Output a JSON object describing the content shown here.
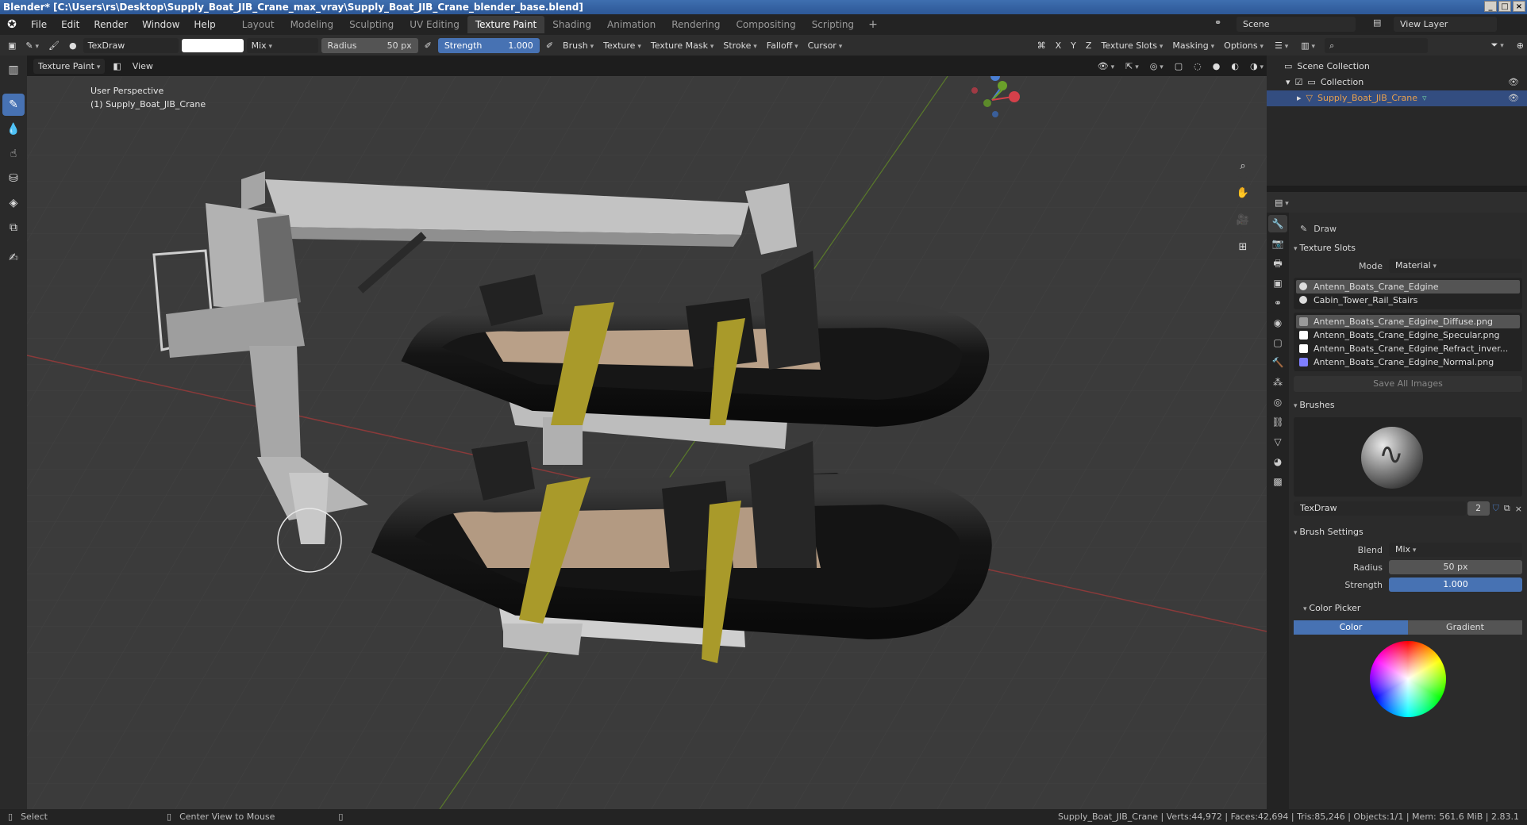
{
  "window": {
    "title": "Blender* [C:\\Users\\rs\\Desktop\\Supply_Boat_JIB_Crane_max_vray\\Supply_Boat_JIB_Crane_blender_base.blend]"
  },
  "menu": [
    "File",
    "Edit",
    "Render",
    "Window",
    "Help"
  ],
  "workspaces": [
    "Layout",
    "Modeling",
    "Sculpting",
    "UV Editing",
    "Texture Paint",
    "Shading",
    "Animation",
    "Rendering",
    "Compositing",
    "Scripting"
  ],
  "active_workspace": "Texture Paint",
  "scene": {
    "scene_name": "Scene",
    "view_layer": "View Layer"
  },
  "tool_header": {
    "brush_name": "TexDraw",
    "blend": "Mix",
    "radius_label": "Radius",
    "radius_value": "50 px",
    "strength_label": "Strength",
    "strength_value": "1.000",
    "menus": [
      "Brush",
      "Texture",
      "Texture Mask",
      "Stroke",
      "Falloff",
      "Cursor"
    ],
    "axis": [
      "X",
      "Y",
      "Z"
    ],
    "right_menus": [
      "Texture Slots",
      "Masking",
      "Options"
    ]
  },
  "view_header": {
    "mode": "Texture Paint",
    "view": "View"
  },
  "viewport": {
    "perspective": "User Perspective",
    "object_label": "(1) Supply_Boat_JIB_Crane"
  },
  "outliner": {
    "root": "Scene Collection",
    "collection": "Collection",
    "object": "Supply_Boat_JIB_Crane"
  },
  "properties": {
    "tool_name": "Draw",
    "texture_slots_title": "Texture Slots",
    "mode_label": "Mode",
    "mode_value": "Material",
    "materials": [
      "Antenn_Boats_Crane_Edgine",
      "Cabin_Tower_Rail_Stairs"
    ],
    "images": [
      {
        "name": "Antenn_Boats_Crane_Edgine_Diffuse.png",
        "color": "#9a9a9a"
      },
      {
        "name": "Antenn_Boats_Crane_Edgine_Specular.png",
        "color": "#ffffff"
      },
      {
        "name": "Antenn_Boats_Crane_Edgine_Refract_inver...",
        "color": "#ffffff"
      },
      {
        "name": "Antenn_Boats_Crane_Edgine_Normal.png",
        "color": "#7f7fff"
      }
    ],
    "save_all": "Save All Images",
    "brushes_title": "Brushes",
    "brush_name": "TexDraw",
    "brush_users": "2",
    "brush_settings_title": "Brush Settings",
    "blend_label": "Blend",
    "blend_value": "Mix",
    "radius_label": "Radius",
    "radius_value": "50 px",
    "strength_label": "Strength",
    "strength_value": "1.000",
    "color_picker_title": "Color Picker",
    "color_tab": "Color",
    "gradient_tab": "Gradient"
  },
  "status": {
    "select": "Select",
    "center": "Center View to Mouse",
    "stats": "Supply_Boat_JIB_Crane | Verts:44,972 | Faces:42,694 | Tris:85,246 | Objects:1/1 | Mem: 561.6 MiB | 2.83.1"
  },
  "colors": {
    "accent": "#4772b3",
    "selected_row": "#334d80",
    "object_orange": "#e8a04d"
  }
}
